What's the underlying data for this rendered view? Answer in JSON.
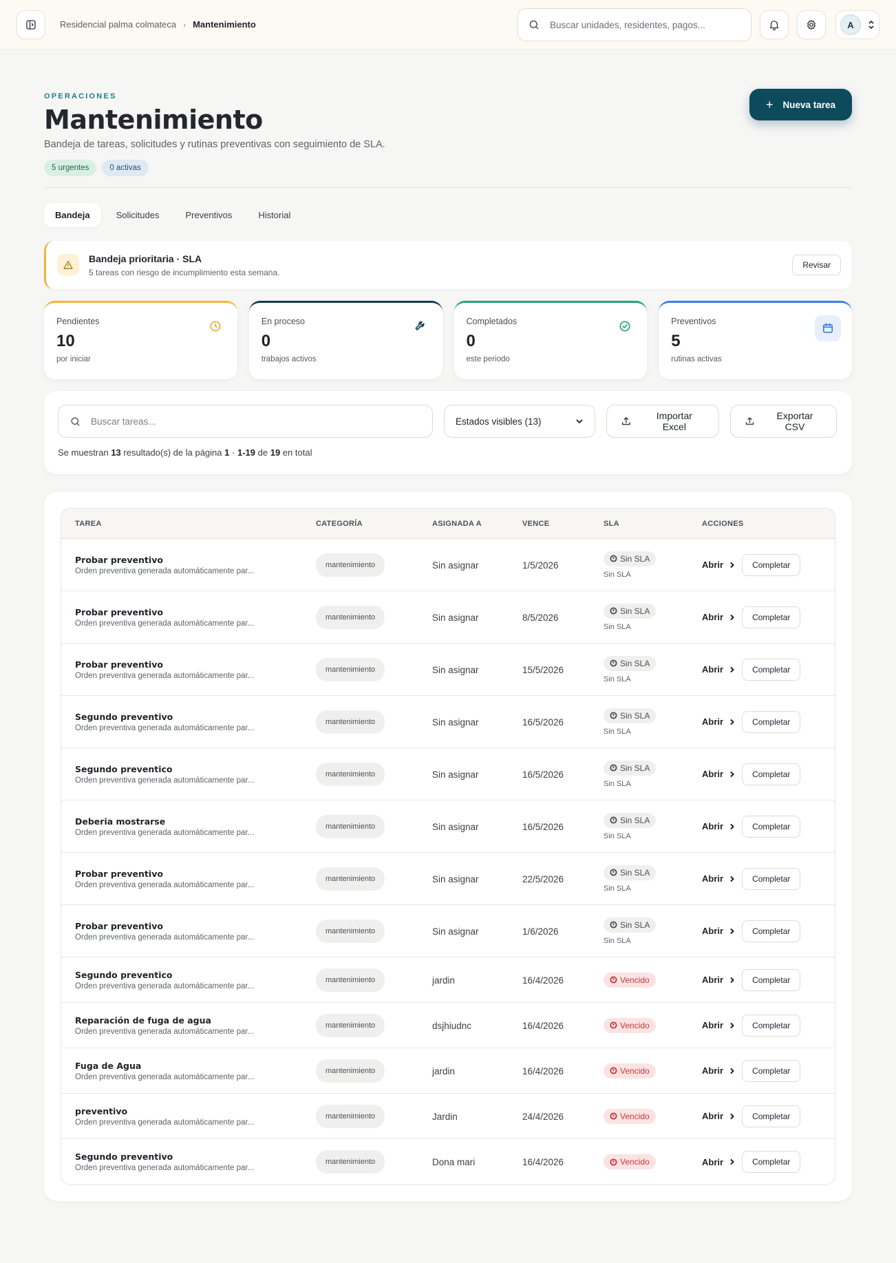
{
  "header": {
    "breadcrumb_parent": "Residencial palma colmateca",
    "breadcrumb_current": "Mantenimiento",
    "search_placeholder": "Buscar unidades, residentes, pagos...",
    "avatar_initial": "A"
  },
  "page": {
    "eyebrow": "OPERACIONES",
    "title": "Mantenimiento",
    "subtitle": "Bandeja de tareas, solicitudes y rutinas preventivas con seguimiento de SLA.",
    "pill_urgent": "5 urgentes",
    "pill_active": "0 activas",
    "new_task_label": "Nueva tarea"
  },
  "tabs": [
    {
      "label": "Bandeja",
      "active": true
    },
    {
      "label": "Solicitudes",
      "active": false
    },
    {
      "label": "Preventivos",
      "active": false
    },
    {
      "label": "Historial",
      "active": false
    }
  ],
  "alert": {
    "title": "Bandeja prioritaria · SLA",
    "description": "5 tareas con riesgo de incumplimiento esta semana.",
    "button": "Revisar"
  },
  "stats": [
    {
      "label": "Pendientes",
      "value": "10",
      "sub": "por iniciar",
      "icon": "clock-icon",
      "color": "#f0b93a"
    },
    {
      "label": "En proceso",
      "value": "0",
      "sub": "trabajos activos",
      "icon": "wrench-icon",
      "color": "#0f3a4d"
    },
    {
      "label": "Completados",
      "value": "0",
      "sub": "este periodo",
      "icon": "check-circle-icon",
      "color": "#1ea672"
    },
    {
      "label": "Preventivos",
      "value": "5",
      "sub": "rutinas activas",
      "icon": "calendar-icon",
      "color": "#3b7fe0"
    }
  ],
  "filters": {
    "search_placeholder": "Buscar tareas...",
    "status_select": "Estados visibles (13)",
    "import_label": "Importar Excel",
    "export_label": "Exportar CSV",
    "results": {
      "prefix": "Se muestran",
      "shown": "13",
      "mid1": "resultado(s) de la página",
      "page": "1",
      "dot": "·",
      "range": "1-19",
      "mid2": "de",
      "total": "19",
      "suffix": "en total"
    }
  },
  "table": {
    "columns": [
      "TAREA",
      "CATEGORÍA",
      "ASIGNADA A",
      "VENCE",
      "SLA",
      "ACCIONES"
    ],
    "open_label": "Abrir",
    "complete_label": "Completar",
    "rows": [
      {
        "title": "Probar preventivo",
        "desc": "Orden preventiva generada automáticamente par...",
        "category": "mantenimiento",
        "assignee": "Sin asignar",
        "due": "1/5/2026",
        "sla": "Sin SLA",
        "sla_sub": "Sin SLA",
        "late": false
      },
      {
        "title": "Probar preventivo",
        "desc": "Orden preventiva generada automáticamente par...",
        "category": "mantenimiento",
        "assignee": "Sin asignar",
        "due": "8/5/2026",
        "sla": "Sin SLA",
        "sla_sub": "Sin SLA",
        "late": false
      },
      {
        "title": "Probar preventivo",
        "desc": "Orden preventiva generada automáticamente par...",
        "category": "mantenimiento",
        "assignee": "Sin asignar",
        "due": "15/5/2026",
        "sla": "Sin SLA",
        "sla_sub": "Sin SLA",
        "late": false
      },
      {
        "title": "Segundo preventivo",
        "desc": "Orden preventiva generada automáticamente par...",
        "category": "mantenimiento",
        "assignee": "Sin asignar",
        "due": "16/5/2026",
        "sla": "Sin SLA",
        "sla_sub": "Sin SLA",
        "late": false
      },
      {
        "title": "Segundo preventico",
        "desc": "Orden preventiva generada automáticamente par...",
        "category": "mantenimiento",
        "assignee": "Sin asignar",
        "due": "16/5/2026",
        "sla": "Sin SLA",
        "sla_sub": "Sin SLA",
        "late": false
      },
      {
        "title": "Deberia mostrarse",
        "desc": "Orden preventiva generada automáticamente par...",
        "category": "mantenimiento",
        "assignee": "Sin asignar",
        "due": "16/5/2026",
        "sla": "Sin SLA",
        "sla_sub": "Sin SLA",
        "late": false
      },
      {
        "title": "Probar preventivo",
        "desc": "Orden preventiva generada automáticamente par...",
        "category": "mantenimiento",
        "assignee": "Sin asignar",
        "due": "22/5/2026",
        "sla": "Sin SLA",
        "sla_sub": "Sin SLA",
        "late": false
      },
      {
        "title": "Probar preventivo",
        "desc": "Orden preventiva generada automáticamente par...",
        "category": "mantenimiento",
        "assignee": "Sin asignar",
        "due": "1/6/2026",
        "sla": "Sin SLA",
        "sla_sub": "Sin SLA",
        "late": false
      },
      {
        "title": "Segundo preventico",
        "desc": "Orden preventiva generada automáticamente par...",
        "category": "mantenimiento",
        "assignee": "jardin",
        "due": "16/4/2026",
        "sla": "Vencido",
        "sla_sub": "",
        "late": true
      },
      {
        "title": "Reparación de fuga de agua",
        "desc": "Orden preventiva generada automáticamente par...",
        "category": "mantenimiento",
        "assignee": "dsjhiudnc",
        "due": "16/4/2026",
        "sla": "Vencido",
        "sla_sub": "",
        "late": true
      },
      {
        "title": "Fuga de Agua",
        "desc": "Orden preventiva generada automáticamente par...",
        "category": "mantenimiento",
        "assignee": "jardin",
        "due": "16/4/2026",
        "sla": "Vencido",
        "sla_sub": "",
        "late": true
      },
      {
        "title": "preventivo",
        "desc": "Orden preventiva generada automáticamente par...",
        "category": "mantenimiento",
        "assignee": "Jardin",
        "due": "24/4/2026",
        "sla": "Vencido",
        "sla_sub": "",
        "late": true
      },
      {
        "title": "Segundo preventivo",
        "desc": "Orden preventiva generada automáticamente par...",
        "category": "mantenimiento",
        "assignee": "Dona mari",
        "due": "16/4/2026",
        "sla": "Vencido",
        "sla_sub": "",
        "late": true
      }
    ]
  }
}
